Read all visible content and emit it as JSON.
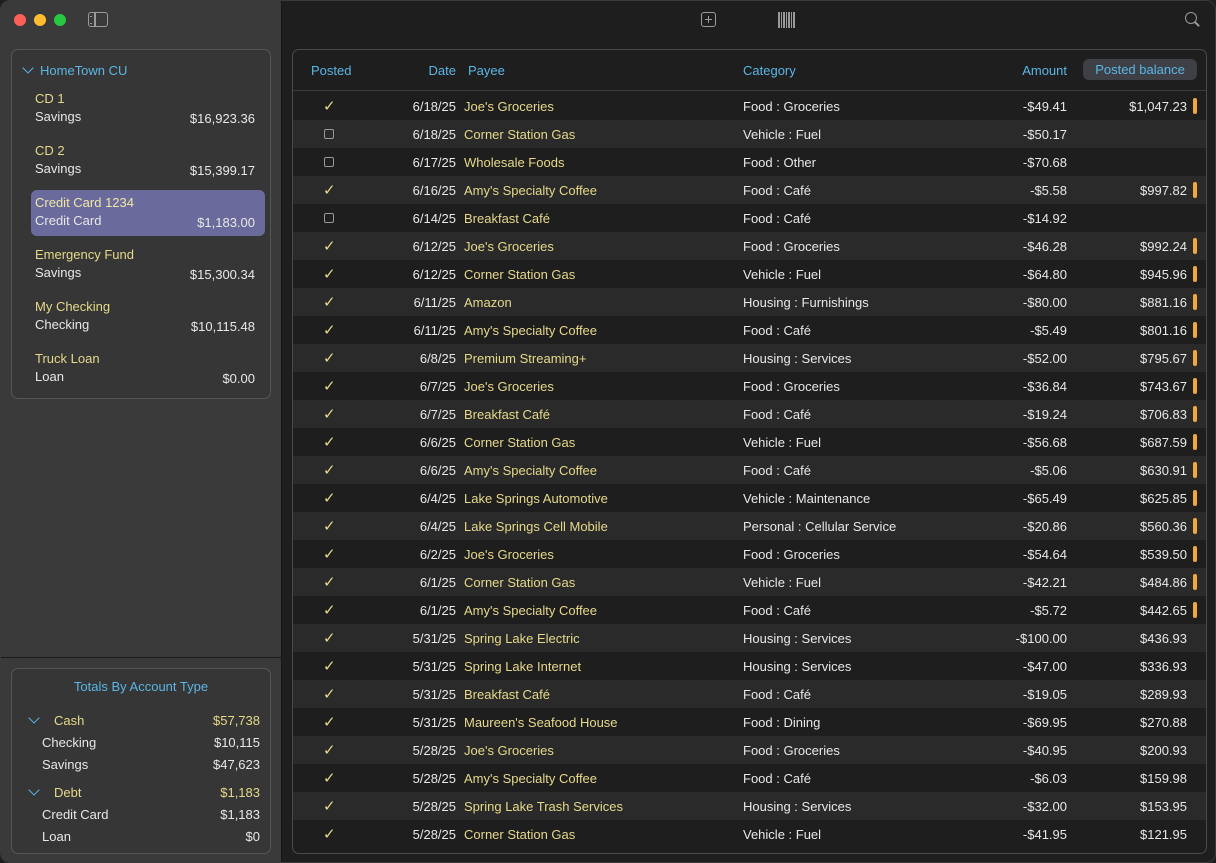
{
  "sidebar": {
    "bank_name": "HomeTown CU",
    "accounts": [
      {
        "name": "CD 1",
        "type": "Savings",
        "balance": "$16,923.36",
        "selected": false
      },
      {
        "name": "CD 2",
        "type": "Savings",
        "balance": "$15,399.17",
        "selected": false
      },
      {
        "name": "Credit Card 1234",
        "type": "Credit Card",
        "balance": "$1,183.00",
        "selected": true
      },
      {
        "name": "Emergency Fund",
        "type": "Savings",
        "balance": "$15,300.34",
        "selected": false
      },
      {
        "name": "My Checking",
        "type": "Checking",
        "balance": "$10,115.48",
        "selected": false
      },
      {
        "name": "Truck Loan",
        "type": "Loan",
        "balance": "$0.00",
        "selected": false
      }
    ],
    "totals": {
      "title": "Totals By Account Type",
      "groups": [
        {
          "name": "Cash",
          "total": "$57,738",
          "items": [
            {
              "name": "Checking",
              "value": "$10,115"
            },
            {
              "name": "Savings",
              "value": "$47,623"
            }
          ]
        },
        {
          "name": "Debt",
          "total": "$1,183",
          "items": [
            {
              "name": "Credit Card",
              "value": "$1,183"
            },
            {
              "name": "Loan",
              "value": "$0"
            }
          ]
        }
      ]
    }
  },
  "toolbar": {
    "icons": [
      "sidebar-toggle-icon",
      "add-transaction-icon",
      "barcode-icon",
      "search-icon"
    ]
  },
  "table": {
    "columns": {
      "posted": "Posted",
      "date": "Date",
      "payee": "Payee",
      "category": "Category",
      "amount": "Amount",
      "balance": "Posted balance"
    },
    "rows": [
      {
        "posted": true,
        "date": "6/18/25",
        "payee": "Joe's Groceries",
        "category": "Food : Groceries",
        "amount": "-$49.41",
        "balance": "$1,047.23"
      },
      {
        "posted": false,
        "date": "6/18/25",
        "payee": "Corner Station Gas",
        "category": "Vehicle : Fuel",
        "amount": "-$50.17",
        "balance": ""
      },
      {
        "posted": false,
        "date": "6/17/25",
        "payee": "Wholesale Foods",
        "category": "Food : Other",
        "amount": "-$70.68",
        "balance": ""
      },
      {
        "posted": true,
        "date": "6/16/25",
        "payee": "Amy's Specialty Coffee",
        "category": "Food : Café",
        "amount": "-$5.58",
        "balance": "$997.82"
      },
      {
        "posted": false,
        "date": "6/14/25",
        "payee": "Breakfast Café",
        "category": "Food : Café",
        "amount": "-$14.92",
        "balance": ""
      },
      {
        "posted": true,
        "date": "6/12/25",
        "payee": "Joe's Groceries",
        "category": "Food : Groceries",
        "amount": "-$46.28",
        "balance": "$992.24"
      },
      {
        "posted": true,
        "date": "6/12/25",
        "payee": "Corner Station Gas",
        "category": "Vehicle : Fuel",
        "amount": "-$64.80",
        "balance": "$945.96"
      },
      {
        "posted": true,
        "date": "6/11/25",
        "payee": "Amazon",
        "category": "Housing : Furnishings",
        "amount": "-$80.00",
        "balance": "$881.16"
      },
      {
        "posted": true,
        "date": "6/11/25",
        "payee": "Amy's Specialty Coffee",
        "category": "Food : Café",
        "amount": "-$5.49",
        "balance": "$801.16"
      },
      {
        "posted": true,
        "date": "6/8/25",
        "payee": "Premium Streaming+",
        "category": "Housing : Services",
        "amount": "-$52.00",
        "balance": "$795.67"
      },
      {
        "posted": true,
        "date": "6/7/25",
        "payee": "Joe's Groceries",
        "category": "Food : Groceries",
        "amount": "-$36.84",
        "balance": "$743.67"
      },
      {
        "posted": true,
        "date": "6/7/25",
        "payee": "Breakfast Café",
        "category": "Food : Café",
        "amount": "-$19.24",
        "balance": "$706.83"
      },
      {
        "posted": true,
        "date": "6/6/25",
        "payee": "Corner Station Gas",
        "category": "Vehicle : Fuel",
        "amount": "-$56.68",
        "balance": "$687.59"
      },
      {
        "posted": true,
        "date": "6/6/25",
        "payee": "Amy's Specialty Coffee",
        "category": "Food : Café",
        "amount": "-$5.06",
        "balance": "$630.91"
      },
      {
        "posted": true,
        "date": "6/4/25",
        "payee": "Lake Springs Automotive",
        "category": "Vehicle : Maintenance",
        "amount": "-$65.49",
        "balance": "$625.85"
      },
      {
        "posted": true,
        "date": "6/4/25",
        "payee": "Lake Springs Cell Mobile",
        "category": "Personal : Cellular Service",
        "amount": "-$20.86",
        "balance": "$560.36"
      },
      {
        "posted": true,
        "date": "6/2/25",
        "payee": "Joe's Groceries",
        "category": "Food : Groceries",
        "amount": "-$54.64",
        "balance": "$539.50"
      },
      {
        "posted": true,
        "date": "6/1/25",
        "payee": "Corner Station Gas",
        "category": "Vehicle : Fuel",
        "amount": "-$42.21",
        "balance": "$484.86"
      },
      {
        "posted": true,
        "date": "6/1/25",
        "payee": "Amy's Specialty Coffee",
        "category": "Food : Café",
        "amount": "-$5.72",
        "balance": "$442.65"
      },
      {
        "posted": true,
        "date": "5/31/25",
        "payee": "Spring Lake Electric",
        "category": "Housing : Services",
        "amount": "-$100.00",
        "balance": "$436.93"
      },
      {
        "posted": true,
        "date": "5/31/25",
        "payee": "Spring Lake Internet",
        "category": "Housing : Services",
        "amount": "-$47.00",
        "balance": "$336.93"
      },
      {
        "posted": true,
        "date": "5/31/25",
        "payee": "Breakfast Café",
        "category": "Food : Café",
        "amount": "-$19.05",
        "balance": "$289.93"
      },
      {
        "posted": true,
        "date": "5/31/25",
        "payee": "Maureen's Seafood House",
        "category": "Food : Dining",
        "amount": "-$69.95",
        "balance": "$270.88"
      },
      {
        "posted": true,
        "date": "5/28/25",
        "payee": "Joe's Groceries",
        "category": "Food : Groceries",
        "amount": "-$40.95",
        "balance": "$200.93"
      },
      {
        "posted": true,
        "date": "5/28/25",
        "payee": "Amy's Specialty Coffee",
        "category": "Food : Café",
        "amount": "-$6.03",
        "balance": "$159.98"
      },
      {
        "posted": true,
        "date": "5/28/25",
        "payee": "Spring Lake Trash Services",
        "category": "Housing : Services",
        "amount": "-$32.00",
        "balance": "$153.95"
      },
      {
        "posted": true,
        "date": "5/28/25",
        "payee": "Corner Station Gas",
        "category": "Vehicle : Fuel",
        "amount": "-$41.95",
        "balance": "$121.95"
      }
    ],
    "balance_bar_rows": 19
  },
  "colors": {
    "accent": "#5ab6e6",
    "payee": "#e6d98a",
    "selected_account": "#6a6a9c",
    "balance_marker": "#f2a93b"
  }
}
